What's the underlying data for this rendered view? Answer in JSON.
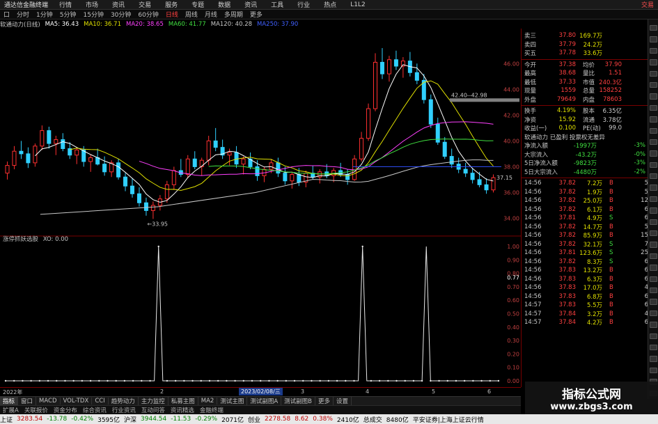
{
  "menubar": {
    "app": "通达信金融终端",
    "items": [
      "行情",
      "市场",
      "资讯",
      "交易",
      "服务",
      "专题",
      "数据",
      "资讯",
      "工具",
      "行业",
      "热点",
      "L1L2"
    ],
    "right": "交易"
  },
  "periodbar": {
    "items": [
      "分时",
      "1分钟",
      "5分钟",
      "15分钟",
      "30分钟",
      "60分钟",
      "日线",
      "周线",
      "月线",
      "多周期",
      "更多"
    ],
    "selected": 6,
    "prefix": "口"
  },
  "malegend": {
    "name": "软通动力(日线)",
    "items": [
      {
        "label": "MA5: 36.43",
        "color": "#ffffff"
      },
      {
        "label": "MA10: 36.71",
        "color": "#e0e000"
      },
      {
        "label": "MA20: 38.65",
        "color": "#ff40ff"
      },
      {
        "label": "MA60: 41.77",
        "color": "#40e040"
      },
      {
        "label": "MA120: 40.28",
        "color": "#c8c8c8"
      },
      {
        "label": "MA250: 37.90",
        "color": "#4060ff"
      }
    ]
  },
  "price_axis": [
    "46.00",
    "44.00",
    "42.00",
    "40.00",
    "38.00",
    "36.00",
    "34.00"
  ],
  "ind_axis": [
    "1.00",
    "0.90",
    "0.80",
    "0.70",
    "0.60",
    "0.50",
    "0.40",
    "0.30",
    "0.20",
    "0.10",
    "0.00"
  ],
  "annotations": {
    "low": "33.95",
    "high_label": "42.40--42.98",
    "last": "37.15",
    "ind_value": "0.77"
  },
  "indicator": {
    "name": "涨停抓妖选股",
    "value": "XO: 0.00"
  },
  "xaxis": {
    "start": "2022年",
    "date_box": "2023/02/08/三",
    "ticks": [
      "2",
      "3",
      "4",
      "5",
      "6"
    ]
  },
  "chart_data": {
    "type": "line",
    "title": "",
    "series": [
      {
        "name": "XO",
        "values": [
          0,
          0,
          0,
          0,
          0,
          0,
          0,
          0,
          0,
          0,
          0,
          0,
          0,
          0,
          0,
          0,
          0,
          0,
          0,
          0,
          0,
          0,
          0,
          0,
          0,
          0,
          0,
          0,
          0,
          0,
          0,
          0,
          0,
          0,
          0,
          0,
          1,
          0,
          0,
          0,
          0,
          0,
          0,
          0,
          0,
          0,
          0,
          0,
          0,
          0,
          0,
          0,
          0,
          0,
          0,
          0,
          0,
          0,
          0,
          0,
          0,
          0,
          0,
          0,
          0,
          0,
          0,
          0,
          0,
          0,
          0,
          0,
          0,
          0,
          0,
          0,
          0,
          0,
          0,
          0,
          0,
          0,
          0,
          0,
          1,
          0,
          0,
          0,
          0,
          0,
          0,
          0,
          0,
          0,
          0,
          0,
          0,
          0,
          0,
          1,
          0,
          0,
          0,
          0,
          0,
          0,
          0,
          0,
          0,
          0,
          0,
          0,
          0,
          0,
          0,
          0,
          0
        ]
      }
    ],
    "ylim": [
      0,
      1
    ]
  },
  "candles": [
    [
      37.5,
      38.4,
      37.0,
      38.1
    ],
    [
      38.1,
      39.6,
      37.8,
      39.2
    ],
    [
      39.2,
      40.0,
      38.6,
      39.0
    ],
    [
      39.0,
      39.5,
      37.9,
      38.3
    ],
    [
      38.3,
      39.8,
      38.0,
      39.6
    ],
    [
      39.6,
      41.2,
      39.3,
      40.8
    ],
    [
      40.8,
      41.1,
      39.4,
      39.8
    ],
    [
      39.8,
      40.4,
      38.9,
      40.1
    ],
    [
      40.1,
      40.6,
      39.2,
      39.4
    ],
    [
      39.4,
      39.9,
      38.6,
      38.9
    ],
    [
      38.9,
      39.5,
      38.2,
      39.3
    ],
    [
      39.3,
      39.6,
      38.0,
      38.4
    ],
    [
      38.4,
      38.9,
      37.6,
      38.7
    ],
    [
      38.7,
      39.4,
      38.1,
      38.2
    ],
    [
      38.2,
      38.8,
      37.3,
      37.6
    ],
    [
      37.6,
      38.5,
      37.2,
      38.3
    ],
    [
      38.3,
      38.6,
      37.0,
      37.2
    ],
    [
      37.2,
      37.5,
      36.1,
      36.5
    ],
    [
      36.5,
      37.1,
      35.6,
      35.9
    ],
    [
      35.9,
      36.4,
      34.9,
      35.2
    ],
    [
      35.2,
      35.6,
      34.2,
      34.6
    ],
    [
      34.6,
      35.3,
      33.95,
      35.0
    ],
    [
      35.0,
      35.8,
      34.6,
      35.5
    ],
    [
      35.5,
      36.9,
      35.2,
      36.6
    ],
    [
      36.6,
      38.0,
      36.2,
      37.7
    ],
    [
      37.7,
      38.6,
      37.2,
      37.4
    ],
    [
      37.4,
      38.9,
      37.1,
      38.6
    ],
    [
      38.6,
      39.2,
      37.8,
      38.0
    ],
    [
      38.0,
      38.7,
      37.3,
      38.5
    ],
    [
      38.5,
      40.4,
      38.1,
      40.0
    ],
    [
      40.0,
      41.0,
      39.2,
      39.5
    ],
    [
      39.5,
      40.1,
      38.6,
      38.9
    ],
    [
      38.9,
      39.4,
      38.1,
      39.1
    ],
    [
      39.1,
      39.6,
      37.9,
      38.2
    ],
    [
      38.2,
      38.8,
      37.4,
      38.6
    ],
    [
      38.6,
      39.1,
      37.8,
      38.0
    ],
    [
      38.0,
      38.5,
      36.9,
      37.3
    ],
    [
      37.3,
      38.0,
      36.8,
      37.8
    ],
    [
      37.8,
      38.6,
      37.5,
      38.3
    ],
    [
      38.3,
      38.7,
      37.2,
      37.5
    ],
    [
      37.5,
      38.0,
      36.6,
      36.9
    ],
    [
      36.9,
      37.6,
      36.3,
      37.4
    ],
    [
      37.4,
      37.9,
      36.5,
      36.8
    ],
    [
      36.8,
      37.7,
      36.4,
      37.5
    ],
    [
      37.5,
      38.1,
      37.0,
      37.2
    ],
    [
      37.2,
      37.8,
      36.7,
      37.6
    ],
    [
      37.6,
      38.2,
      37.1,
      37.3
    ],
    [
      37.3,
      37.9,
      36.8,
      37.7
    ],
    [
      37.7,
      38.3,
      37.2,
      37.4
    ],
    [
      37.4,
      37.8,
      36.6,
      37.0
    ],
    [
      37.0,
      38.9,
      36.9,
      38.6
    ],
    [
      38.6,
      40.7,
      38.4,
      40.2
    ],
    [
      40.2,
      42.9,
      40.0,
      42.5
    ],
    [
      42.5,
      46.8,
      42.3,
      46.1
    ],
    [
      46.1,
      47.2,
      44.8,
      45.2
    ],
    [
      45.2,
      46.6,
      44.6,
      46.3
    ],
    [
      46.3,
      47.0,
      45.5,
      45.8
    ],
    [
      45.8,
      46.5,
      44.9,
      46.2
    ],
    [
      46.2,
      46.9,
      45.0,
      45.3
    ],
    [
      45.3,
      46.0,
      44.4,
      44.7
    ],
    [
      44.7,
      45.2,
      42.9,
      43.2
    ],
    [
      43.2,
      43.6,
      41.0,
      41.3
    ],
    [
      41.3,
      41.8,
      39.7,
      39.9
    ],
    [
      39.9,
      40.3,
      38.6,
      38.8
    ],
    [
      38.8,
      39.4,
      37.9,
      38.2
    ],
    [
      38.2,
      38.7,
      37.5,
      37.8
    ],
    [
      37.8,
      38.3,
      37.2,
      37.5
    ],
    [
      37.5,
      37.9,
      36.7,
      37.0
    ],
    [
      37.0,
      37.6,
      36.4,
      36.6
    ],
    [
      36.6,
      37.1,
      35.9,
      36.2
    ],
    [
      36.2,
      37.4,
      36.0,
      37.15
    ]
  ],
  "quote": {
    "rows_top": [
      {
        "l": "卖三",
        "v": "37.80",
        "q": "169.7万"
      },
      {
        "l": "卖四",
        "v": "37.79",
        "q": "24.2万"
      },
      {
        "l": "买五",
        "v": "37.78",
        "q": "33.6万"
      }
    ],
    "rows_info": [
      {
        "a": "今开",
        "b": "37.38",
        "c": "均价",
        "d": "37.90"
      },
      {
        "a": "最高",
        "b": "38.68",
        "c": "量比",
        "d": "1.51"
      },
      {
        "a": "最低",
        "b": "37.33",
        "c": "市值",
        "d": "240.3亿"
      },
      {
        "a": "现量",
        "b": "1559",
        "c": "总量",
        "d": "158252"
      },
      {
        "a": "外盘",
        "b": "79649",
        "c": "内盘",
        "d": "78603"
      }
    ],
    "rows_fin": [
      {
        "a": "换手",
        "b": "4.19%",
        "c": "股本",
        "d": "6.35亿"
      },
      {
        "a": "净资",
        "b": "15.92",
        "c": "流通",
        "d": "3.78亿"
      },
      {
        "a": "收益(一)",
        "b": "0.100",
        "c": "PE(动)",
        "d": "99.0"
      }
    ],
    "tags": "软通动力 已盈利 投票权无差异",
    "flows": [
      {
        "a": "净流入额",
        "b": "-1997万",
        "c": "-3%"
      },
      {
        "a": "大宗流入",
        "b": "-43.2万",
        "c": "-0%"
      },
      {
        "a": "5日净流入额",
        "b": "-9823万",
        "c": "-3%"
      },
      {
        "a": "5日大宗流入",
        "b": "-4480万",
        "c": "-2%"
      }
    ],
    "ticks": [
      {
        "t": "14:56",
        "p": "37.82",
        "v": "7.2万",
        "f": "B",
        "n": "5"
      },
      {
        "t": "14:56",
        "p": "37.82",
        "v": "1.9万",
        "f": "B",
        "n": "5"
      },
      {
        "t": "14:56",
        "p": "37.82",
        "v": "25.0万",
        "f": "B",
        "n": "12"
      },
      {
        "t": "14:56",
        "p": "37.82",
        "v": "6.1万",
        "f": "B",
        "n": "6"
      },
      {
        "t": "14:56",
        "p": "37.81",
        "v": "4.9万",
        "f": "S",
        "n": "6"
      },
      {
        "t": "14:56",
        "p": "37.82",
        "v": "14.7万",
        "f": "B",
        "n": "5"
      },
      {
        "t": "14:56",
        "p": "37.82",
        "v": "85.9万",
        "f": "B",
        "n": "15"
      },
      {
        "t": "14:56",
        "p": "37.82",
        "v": "32.1万",
        "f": "S",
        "n": "7"
      },
      {
        "t": "14:56",
        "p": "37.81",
        "v": "123.6万",
        "f": "S",
        "n": "25"
      },
      {
        "t": "14:56",
        "p": "37.82",
        "v": "8.3万",
        "f": "S",
        "n": "6"
      },
      {
        "t": "14:56",
        "p": "37.83",
        "v": "13.2万",
        "f": "B",
        "n": "6"
      },
      {
        "t": "14:56",
        "p": "37.83",
        "v": "6.3万",
        "f": "B",
        "n": "6"
      },
      {
        "t": "14:56",
        "p": "37.83",
        "v": "17.0万",
        "f": "B",
        "n": "4"
      },
      {
        "t": "14:56",
        "p": "37.83",
        "v": "6.8万",
        "f": "B",
        "n": "6"
      },
      {
        "t": "14:57",
        "p": "37.83",
        "v": "5.5万",
        "f": "B",
        "n": "6"
      },
      {
        "t": "14:57",
        "p": "37.84",
        "v": "3.2万",
        "f": "B",
        "n": "4"
      },
      {
        "t": "14:57",
        "p": "37.84",
        "v": "4.2万",
        "f": "B",
        "n": "6"
      }
    ]
  },
  "tabs": [
    "指标",
    "窗口",
    "MACD",
    "VOL-TDX",
    "CCI",
    "趋势动力",
    "主力监控",
    "私募主图",
    "MA2",
    "测试主图",
    "测试副图A",
    "测试副图B",
    "更多",
    "设置"
  ],
  "subtabs": [
    "扩展A",
    "关联报价",
    "资金分布",
    "综合资讯",
    "行业资讯",
    "互动问答",
    "资讯精选",
    "金融终端"
  ],
  "status": {
    "sh_label": "上证",
    "sh_val": "3283.54",
    "sh_chg": "-13.78",
    "sh_pct": "-0.42%",
    "sh_amt": "3595亿",
    "hs_label": "沪深",
    "hs_val": "3944.54",
    "hs_chg": "-11.53",
    "hs_pct": "-0.29%",
    "hs_amt": "2071亿",
    "cy_label": "创业",
    "cy_val": "2278.58",
    "cy_chg": "8.62",
    "cy_pct": "0.38%",
    "cy_amt": "2410亿",
    "total_label": "总成交",
    "total": "8480亿",
    "broker": "平安证券|上海上证云行情"
  },
  "watermark": {
    "t1": "指标公式网",
    "t2": "www.zbgs3.com"
  }
}
